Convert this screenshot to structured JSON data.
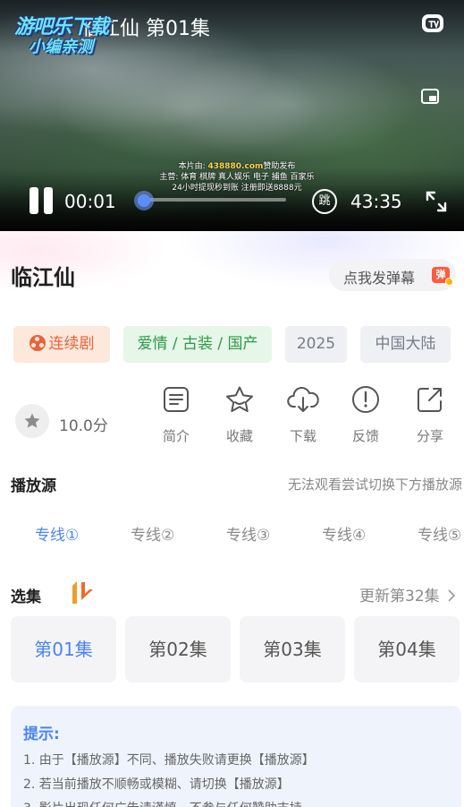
{
  "watermark": {
    "line1": "游吧乐下载",
    "line2": "小编亲测"
  },
  "player": {
    "title": "临江仙 第01集",
    "current_time": "00:01",
    "total_time": "43:35",
    "progress": 0.0004,
    "skip_label": "跳",
    "ad_lines": [
      {
        "prefix": "本片由: ",
        "highlight": "438880.com",
        "suffix": "赞助发布"
      },
      {
        "prefix": "主营: 体育 棋牌 真人娱乐 电子 捕鱼 百家乐",
        "highlight": "",
        "suffix": ""
      },
      {
        "prefix": "24小时提现秒到账 注册即送8888元",
        "highlight": "",
        "suffix": ""
      }
    ],
    "icons": {
      "tv": "tv-icon",
      "pip": "picture-in-picture-icon",
      "play_pause": "pause-icon",
      "fullscreen": "fullscreen-icon"
    }
  },
  "info": {
    "title": "临江仙",
    "danmaku_label": "点我发弹幕",
    "danmaku_icon_text": "弹"
  },
  "tags": {
    "type": "连续剧",
    "genre": "爱情 / 古装 / 国产",
    "year": "2025",
    "region": "中国大陆"
  },
  "rating": {
    "score": "10.0分"
  },
  "actions": [
    {
      "label": "简介",
      "icon": "document-icon"
    },
    {
      "label": "收藏",
      "icon": "star-icon"
    },
    {
      "label": "下载",
      "icon": "cloud-download-icon"
    },
    {
      "label": "反馈",
      "icon": "alert-icon"
    },
    {
      "label": "分享",
      "icon": "share-icon"
    }
  ],
  "source": {
    "title": "播放源",
    "hint": "无法观看尝试切换下方播放源",
    "lines": [
      "专线①",
      "专线②",
      "专线③",
      "专线④",
      "专线⑤"
    ],
    "active_index": 0
  },
  "episodes": {
    "title": "选集",
    "update_label": "更新第32集",
    "items": [
      "第01集",
      "第02集",
      "第03集",
      "第04集"
    ],
    "active_index": 0
  },
  "tips": {
    "title": "提示:",
    "lines": [
      "1. 由于【播放源】不同、播放失败请更换【播放源】",
      "2. 若当前播放不顺畅或模糊、请切换【播放源】",
      "3. 影片出现任何广告请谨慎，不参与任何赞助支持"
    ]
  },
  "colors": {
    "accent": "#4a84f0",
    "tag_type": "#e8643a",
    "tag_genre": "#2e9a48",
    "progress": "#4d7dff",
    "danmaku": "#ff5a3c"
  }
}
